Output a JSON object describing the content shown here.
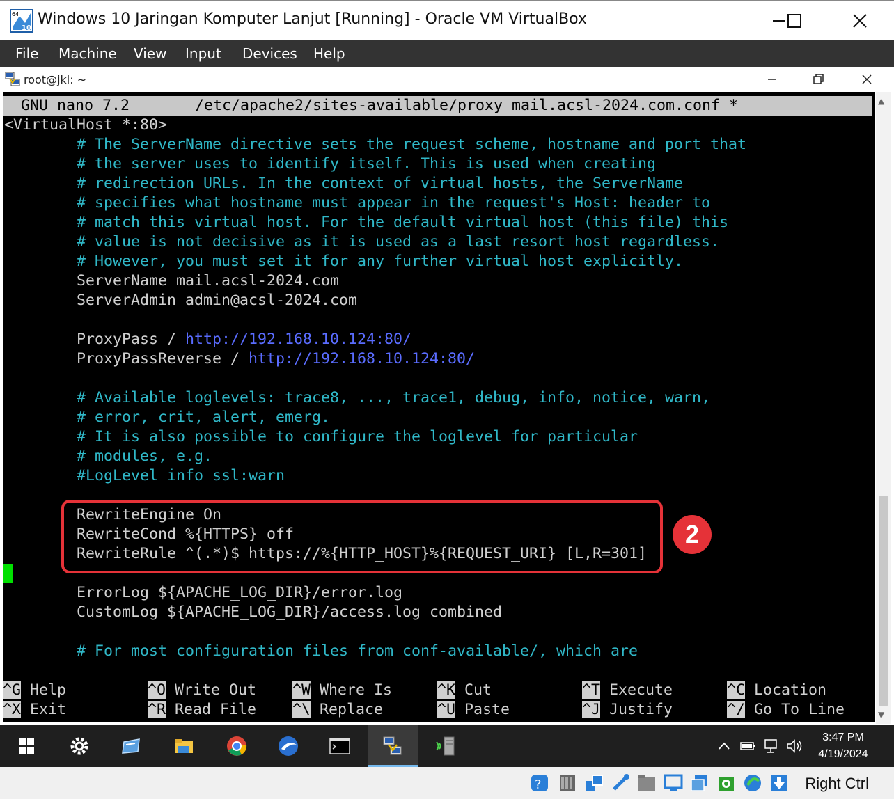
{
  "window": {
    "title": "Windows 10 Jaringan Komputer Lanjut [Running] - Oracle VM VirtualBox",
    "icon_badge_top": "64",
    "icon_badge_bottom": "10"
  },
  "menu": [
    "File",
    "Machine",
    "View",
    "Input",
    "Devices",
    "Help"
  ],
  "guest_window": {
    "title": "root@jkl: ~"
  },
  "nano": {
    "version": "GNU nano 7.2",
    "file": "/etc/apache2/sites-available/proxy_mail.acsl-2024.com.conf *"
  },
  "lines": [
    "<VirtualHost *:80>",
    "        # The ServerName directive sets the request scheme, hostname and port that",
    "        # the server uses to identify itself. This is used when creating",
    "        # redirection URLs. In the context of virtual hosts, the ServerName",
    "        # specifies what hostname must appear in the request's Host: header to",
    "        # match this virtual host. For the default virtual host (this file) this",
    "        # value is not decisive as it is used as a last resort host regardless.",
    "        # However, you must set it for any further virtual host explicitly.",
    "        ServerName mail.acsl-2024.com",
    "        ServerAdmin admin@acsl-2024.com",
    "",
    "        ProxyPass / ",
    "        ProxyPassReverse / ",
    "",
    "        # Available loglevels: trace8, ..., trace1, debug, info, notice, warn,",
    "        # error, crit, alert, emerg.",
    "        # It is also possible to configure the loglevel for particular",
    "        # modules, e.g.",
    "        #LogLevel info ssl:warn",
    "",
    "        RewriteEngine On",
    "        RewriteCond %{HTTPS} off",
    "        RewriteRule ^(.*)$ https://%{HTTP_HOST}%{REQUEST_URI} [L,R=301]",
    "",
    "        ErrorLog ${APACHE_LOG_DIR}/error.log",
    "        CustomLog ${APACHE_LOG_DIR}/access.log combined",
    "",
    "        # For most configuration files from conf-available/, which are"
  ],
  "urls": {
    "proxy_pass": "http://192.168.10.124:80/",
    "proxy_pass_reverse": "http://192.168.10.124:80/"
  },
  "shortcuts": [
    {
      "key": "^G",
      "label": "Help"
    },
    {
      "key": "^O",
      "label": "Write Out"
    },
    {
      "key": "^W",
      "label": "Where Is"
    },
    {
      "key": "^K",
      "label": "Cut"
    },
    {
      "key": "^T",
      "label": "Execute"
    },
    {
      "key": "^C",
      "label": "Location"
    },
    {
      "key": "^X",
      "label": "Exit"
    },
    {
      "key": "^R",
      "label": "Read File"
    },
    {
      "key": "^\\",
      "label": "Replace"
    },
    {
      "key": "^U",
      "label": "Paste"
    },
    {
      "key": "^J",
      "label": "Justify"
    },
    {
      "key": "^/",
      "label": "Go To Line"
    }
  ],
  "annotation": {
    "badge": "2",
    "color": "#e53238"
  },
  "taskbar": {
    "time": "3:47 PM",
    "date": "4/19/2024",
    "icons": [
      "windows-start-icon",
      "settings-icon",
      "remote-desktop-icon",
      "file-explorer-icon",
      "chrome-icon",
      "wireshark-icon",
      "terminal-icon",
      "putty-icon",
      "network-tool-icon"
    ]
  },
  "statusbar": {
    "host_key": "Right Ctrl"
  }
}
